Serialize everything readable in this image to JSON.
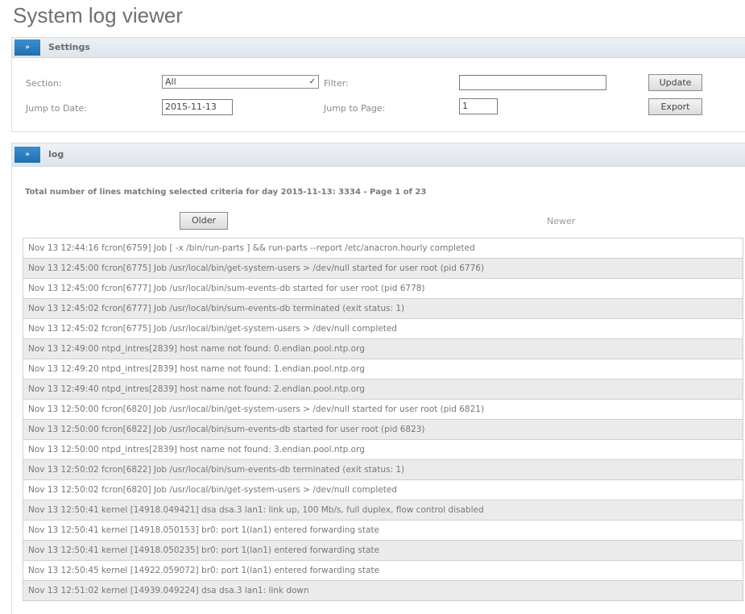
{
  "title": "System log viewer",
  "settings": {
    "header": "Settings",
    "section_label": "Section:",
    "section_value": "All",
    "filter_label": "Filter:",
    "filter_value": "",
    "update_label": "Update",
    "jump_date_label": "Jump to Date:",
    "jump_date_value": "2015-11-13",
    "jump_page_label": "Jump to Page:",
    "jump_page_value": "1",
    "export_label": "Export"
  },
  "log": {
    "header": "log",
    "summary": "Total number of lines matching selected criteria for day 2015-11-13: 3334 - Page 1 of 23",
    "older_label": "Older",
    "newer_label": "Newer",
    "rows": [
      "Nov 13 12:44:16 fcron[6759] Job [ -x /bin/run-parts ] && run-parts --report /etc/anacron.hourly completed",
      "Nov 13 12:45:00 fcron[6775] Job /usr/local/bin/get-system-users > /dev/null started for user root (pid 6776)",
      "Nov 13 12:45:00 fcron[6777] Job /usr/local/bin/sum-events-db started for user root (pid 6778)",
      "Nov 13 12:45:02 fcron[6777] Job /usr/local/bin/sum-events-db terminated (exit status: 1)",
      "Nov 13 12:45:02 fcron[6775] Job /usr/local/bin/get-system-users > /dev/null completed",
      "Nov 13 12:49:00 ntpd_intres[2839] host name not found: 0.endian.pool.ntp.org",
      "Nov 13 12:49:20 ntpd_intres[2839] host name not found: 1.endian.pool.ntp.org",
      "Nov 13 12:49:40 ntpd_intres[2839] host name not found: 2.endian.pool.ntp.org",
      "Nov 13 12:50:00 fcron[6820] Job /usr/local/bin/get-system-users > /dev/null started for user root (pid 6821)",
      "Nov 13 12:50:00 fcron[6822] Job /usr/local/bin/sum-events-db started for user root (pid 6823)",
      "Nov 13 12:50:00 ntpd_intres[2839] host name not found: 3.endian.pool.ntp.org",
      "Nov 13 12:50:02 fcron[6822] Job /usr/local/bin/sum-events-db terminated (exit status: 1)",
      "Nov 13 12:50:02 fcron[6820] Job /usr/local/bin/get-system-users > /dev/null completed",
      "Nov 13 12:50:41 kernel [14918.049421] dsa dsa.3 lan1: link up, 100 Mb/s, full duplex, flow control disabled",
      "Nov 13 12:50:41 kernel [14918.050153] br0: port 1(lan1) entered forwarding state",
      "Nov 13 12:50:41 kernel [14918.050235] br0: port 1(lan1) entered forwarding state",
      "Nov 13 12:50:45 kernel [14922.059072] br0: port 1(lan1) entered forwarding state",
      "Nov 13 12:51:02 kernel [14939.049224] dsa dsa.3 lan1: link down"
    ]
  }
}
